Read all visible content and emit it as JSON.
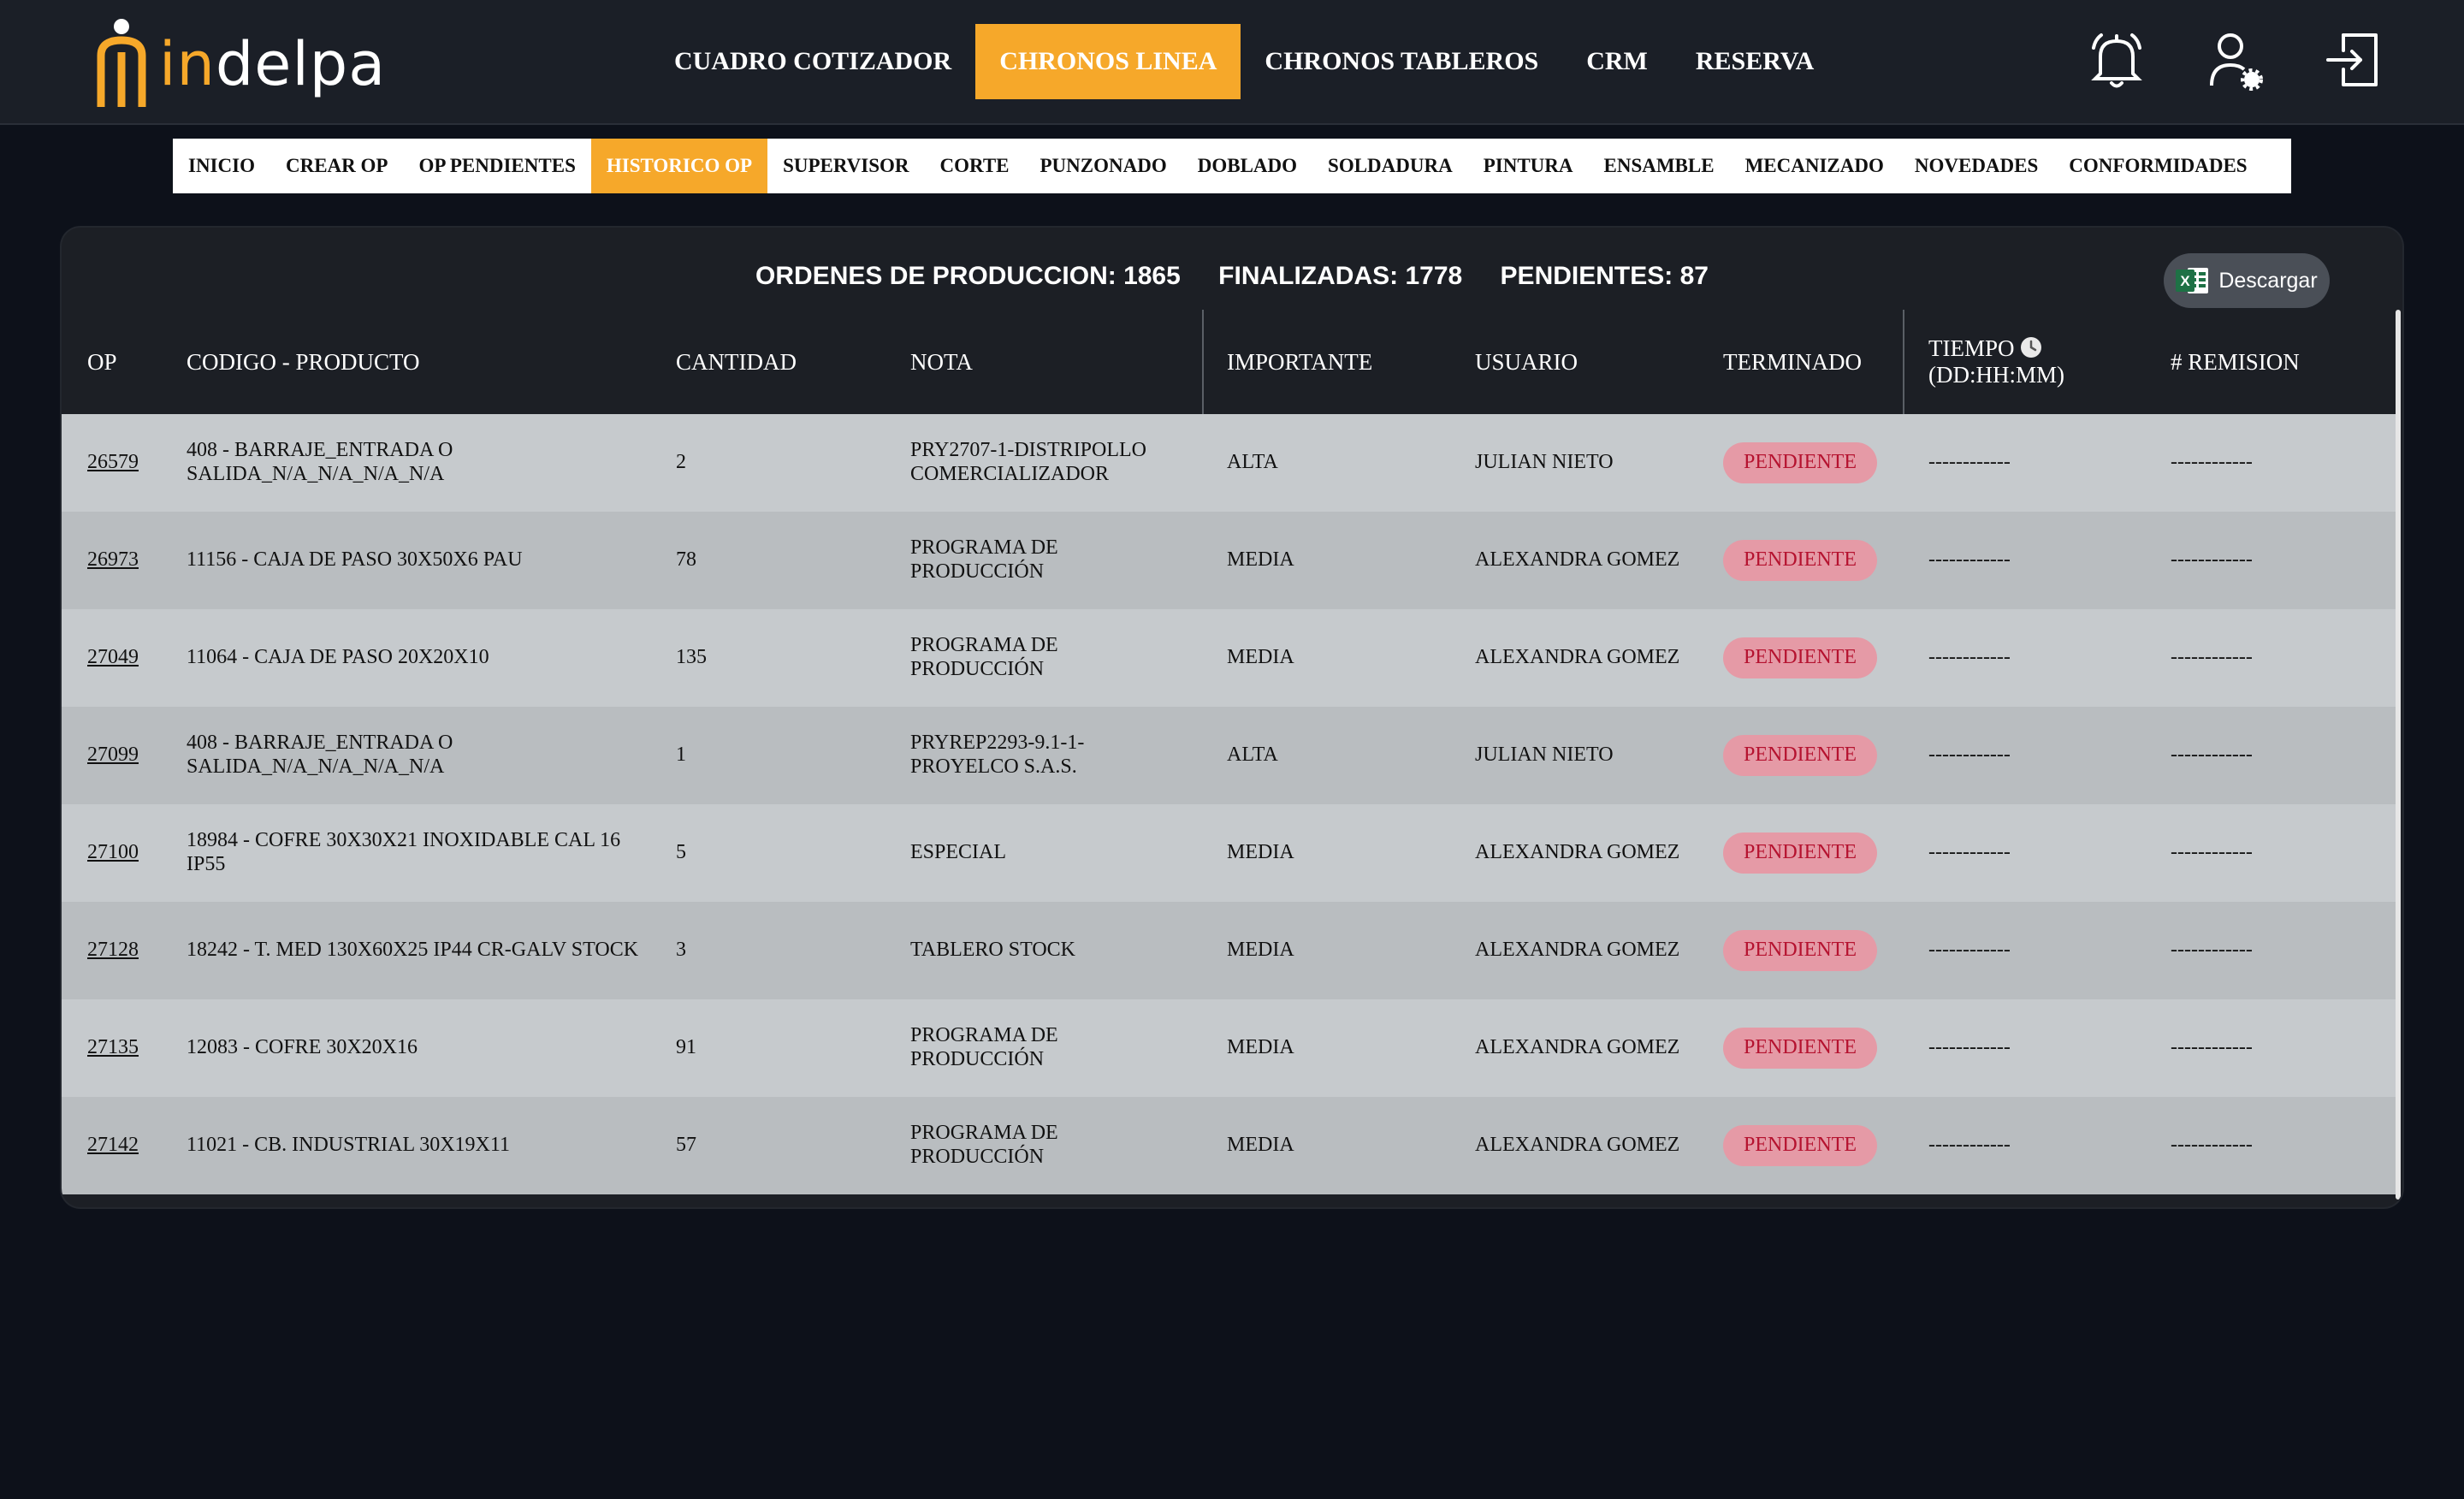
{
  "brand": {
    "logo_part1": "in",
    "logo_part2": "delpa"
  },
  "main_nav": [
    {
      "label": "CUADRO COTIZADOR",
      "active": false
    },
    {
      "label": "CHRONOS LINEA",
      "active": true
    },
    {
      "label": "CHRONOS TABLEROS",
      "active": false
    },
    {
      "label": "CRM",
      "active": false
    },
    {
      "label": "RESERVA",
      "active": false
    }
  ],
  "top_icons": [
    "bell-icon",
    "user-settings-icon",
    "logout-icon"
  ],
  "sub_nav": [
    {
      "label": "INICIO",
      "active": false
    },
    {
      "label": "CREAR OP",
      "active": false
    },
    {
      "label": "OP PENDIENTES",
      "active": false
    },
    {
      "label": "HISTORICO OP",
      "active": true
    },
    {
      "label": "SUPERVISOR",
      "active": false
    },
    {
      "label": "CORTE",
      "active": false
    },
    {
      "label": "PUNZONADO",
      "active": false
    },
    {
      "label": "DOBLADO",
      "active": false
    },
    {
      "label": "SOLDADURA",
      "active": false
    },
    {
      "label": "PINTURA",
      "active": false
    },
    {
      "label": "ENSAMBLE",
      "active": false
    },
    {
      "label": "MECANIZADO",
      "active": false
    },
    {
      "label": "NOVEDADES",
      "active": false
    },
    {
      "label": "CONFORMIDADES",
      "active": false
    }
  ],
  "summary": {
    "ordenes": "ORDENES DE PRODUCCION: 1865",
    "finalizadas": "FINALIZADAS: 1778",
    "pendientes": "PENDIENTES: 87"
  },
  "download": {
    "label": "Descargar",
    "icon": "excel-icon"
  },
  "table": {
    "headers": {
      "op": "OP",
      "codigo": "CODIGO - PRODUCTO",
      "cantidad": "CANTIDAD",
      "nota": "NOTA",
      "importante": "IMPORTANTE",
      "usuario": "USUARIO",
      "terminado": "TERMINADO",
      "tiempo_line1": "TIEMPO",
      "tiempo_line2": "(DD:HH:MM)",
      "remision": "# REMISION"
    },
    "rows": [
      {
        "op": "26579",
        "codigo": "408 - BARRAJE_ENTRADA O SALIDA_N/A_N/A_N/A_N/A",
        "cantidad": "2",
        "nota": "PRY2707-1-DISTRIPOLLO COMERCIALIZADOR",
        "importante": "ALTA",
        "usuario": "JULIAN NIETO",
        "terminado": "PENDIENTE",
        "tiempo": "------------",
        "remision": "------------"
      },
      {
        "op": "26973",
        "codigo": "11156 - CAJA DE PASO 30X50X6 PAU",
        "cantidad": "78",
        "nota": "PROGRAMA DE PRODUCCIÓN",
        "importante": "MEDIA",
        "usuario": "ALEXANDRA GOMEZ",
        "terminado": "PENDIENTE",
        "tiempo": "------------",
        "remision": "------------"
      },
      {
        "op": "27049",
        "codigo": "11064 - CAJA DE PASO 20X20X10",
        "cantidad": "135",
        "nota": "PROGRAMA DE PRODUCCIÓN",
        "importante": "MEDIA",
        "usuario": "ALEXANDRA GOMEZ",
        "terminado": "PENDIENTE",
        "tiempo": "------------",
        "remision": "------------"
      },
      {
        "op": "27099",
        "codigo": "408 - BARRAJE_ENTRADA O SALIDA_N/A_N/A_N/A_N/A",
        "cantidad": "1",
        "nota": "PRYREP2293-9.1-1-PROYELCO S.A.S.",
        "importante": "ALTA",
        "usuario": "JULIAN NIETO",
        "terminado": "PENDIENTE",
        "tiempo": "------------",
        "remision": "------------"
      },
      {
        "op": "27100",
        "codigo": "18984 - COFRE 30X30X21 INOXIDABLE CAL 16 IP55",
        "cantidad": "5",
        "nota": "ESPECIAL",
        "importante": "MEDIA",
        "usuario": "ALEXANDRA GOMEZ",
        "terminado": "PENDIENTE",
        "tiempo": "------------",
        "remision": "------------"
      },
      {
        "op": "27128",
        "codigo": "18242 - T. MED 130X60X25 IP44 CR-GALV STOCK",
        "cantidad": "3",
        "nota": "TABLERO STOCK",
        "importante": "MEDIA",
        "usuario": "ALEXANDRA GOMEZ",
        "terminado": "PENDIENTE",
        "tiempo": "------------",
        "remision": "------------"
      },
      {
        "op": "27135",
        "codigo": "12083 - COFRE 30X20X16",
        "cantidad": "91",
        "nota": "PROGRAMA DE PRODUCCIÓN",
        "importante": "MEDIA",
        "usuario": "ALEXANDRA GOMEZ",
        "terminado": "PENDIENTE",
        "tiempo": "------------",
        "remision": "------------"
      },
      {
        "op": "27142",
        "codigo": "11021 - CB. INDUSTRIAL 30X19X11",
        "cantidad": "57",
        "nota": "PROGRAMA DE PRODUCCIÓN",
        "importante": "MEDIA",
        "usuario": "ALEXANDRA GOMEZ",
        "terminado": "PENDIENTE",
        "tiempo": "------------",
        "remision": "------------"
      }
    ]
  },
  "colors": {
    "accent": "#f6a82a",
    "topbar": "#1b1f27",
    "page_bg": "#0d111a",
    "badge_bg": "#e59aa6",
    "badge_text": "#b5122f"
  }
}
